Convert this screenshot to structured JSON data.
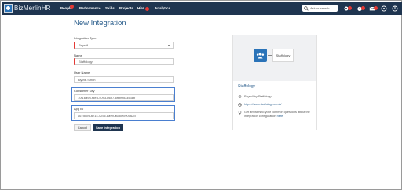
{
  "brand": {
    "name": "BizMerlinHR"
  },
  "nav": {
    "items": [
      "People",
      "Performance",
      "Skills",
      "Projects",
      "Hire",
      "Analytics"
    ],
    "search_placeholder": "Ask or search"
  },
  "page": {
    "title": "New Integration"
  },
  "form": {
    "integration_type_label": "Integration Type",
    "integration_type_value": "Payroll",
    "name_label": "Name",
    "name_value": "Staffology",
    "user_name_label": "User Name",
    "user_name_value": "Blythe.Smith",
    "consumer_key_label": "Consumer Key",
    "consumer_key_value": "10f16a95-fde3-4093-b6b7-6f6b0d33538b",
    "app_id_label": "App ID",
    "app_id_value": "a67d0c9-a214-425c-8a99-a6d0ec90062d",
    "cancel_label": "Cancel",
    "save_label": "Save Integration"
  },
  "card": {
    "tile_label": "Staffology",
    "title": "Staffology",
    "powered_by": "Payroll by Staffology",
    "url": "https://www.staffology.co.uk/",
    "help_text": "Get answers to your common questions about the integration configuration ",
    "help_link": "here."
  },
  "colors": {
    "navbar": "#1f3550",
    "accent": "#2b5e8c",
    "brand_blue": "#2a73b8",
    "badge": "#e53935",
    "highlight": "#4a7fd0"
  }
}
